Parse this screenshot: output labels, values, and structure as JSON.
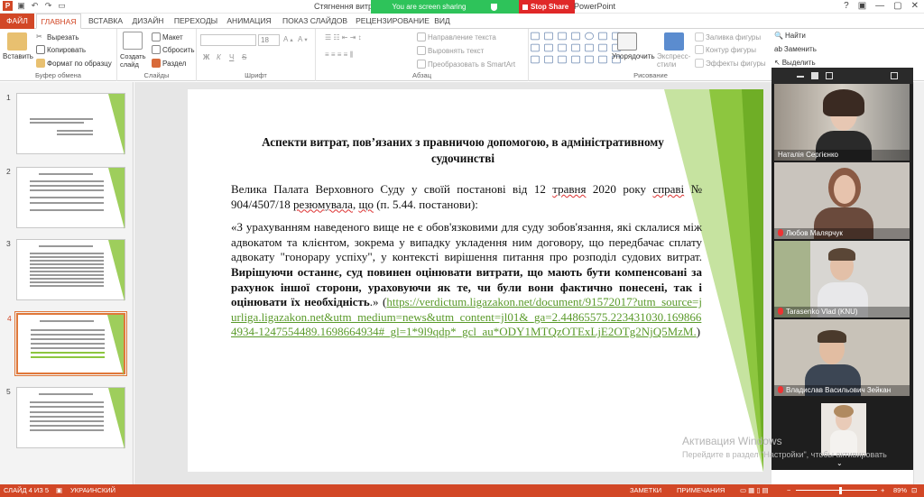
{
  "titlebar": {
    "doc_title": "Стягнення витрат",
    "app_title": "PowerPoint",
    "sharing_text": "You are screen sharing",
    "stop_share": "Stop Share",
    "qat_icons": [
      "powerpoint-icon",
      "save-icon",
      "undo-icon",
      "redo-icon",
      "slideshow-icon"
    ],
    "window_buttons": [
      "?",
      "▢",
      "—",
      "▢",
      "✕"
    ]
  },
  "tabs": [
    "ФАЙЛ",
    "ГЛАВНАЯ",
    "ВСТАВКА",
    "ДИЗАЙН",
    "ПЕРЕХОДЫ",
    "АНИМАЦИЯ",
    "ПОКАЗ СЛАЙДОВ",
    "РЕЦЕНЗИРОВАНИЕ",
    "ВИД"
  ],
  "ribbon": {
    "clipboard": {
      "paste": "Вставить",
      "cut": "Вырезать",
      "copy": "Копировать",
      "format_painter": "Формат по образцу",
      "label": "Буфер обмена"
    },
    "slides": {
      "new_slide": "Создать слайд",
      "layout": "Макет",
      "reset": "Сбросить",
      "section": "Раздел",
      "label": "Слайды"
    },
    "font": {
      "size": "18",
      "label": "Шрифт",
      "bold": "Ж",
      "italic": "К",
      "underline": "Ч",
      "strike": "S"
    },
    "paragraph": {
      "text_direction": "Направление текста",
      "align_text": "Выровнять текст",
      "smartart": "Преобразовать в SmartArt",
      "label": "Абзац"
    },
    "drawing": {
      "arrange": "Упорядочить",
      "quick_styles": "Экспресс-стили",
      "shape_fill": "Заливка фигуры",
      "shape_outline": "Контур фигуры",
      "shape_effects": "Эффекты фигуры",
      "label": "Рисование"
    },
    "editing": {
      "find": "Найти",
      "replace": "Заменить",
      "select": "Выделить"
    }
  },
  "thumbnails": [
    {
      "num": "1"
    },
    {
      "num": "2"
    },
    {
      "num": "3"
    },
    {
      "num": "4"
    },
    {
      "num": "5"
    }
  ],
  "slide": {
    "title": "Аспекти витрат, пов’язаних з правничою допомогою, в адміністративному судочинстві",
    "p1_a": "Велика Палата Верховного Суду у своїй постанові від 12 ",
    "p1_may": "травня",
    "p1_b": " 2020 року ",
    "p1_case": "справі",
    "p1_c": " № 904/4507/18 ",
    "p1_resolved": "резюмувала",
    "p1_d": ", ",
    "p1_that": "що",
    "p1_e": " (п. 5.44. постанови):",
    "p2_a": "«З урахуванням наведеного вище не є обов'язковими для суду зобов'язання, які склалися між адвокатом та клієнтом, зокрема у випадку укладення ним договору, що передбачає сплату адвокату \"гонорару успіху\", у контексті вирішення питання про розподіл судових витрат. ",
    "p2_bold": "Вирішуючи останнє, суд повинен оцінювати витрати, що мають бути компенсовані за рахунок іншої сторони, ураховуючи як те, чи були вони фактично понесені, так і оцінювати їх необхідність",
    "p2_b": ".» (",
    "link": "https://verdictum.ligazakon.net/document/91572017?utm_source=jurliga.ligazakon.net&utm_medium=news&utm_content=jl01&_ga=2.44865575.223431030.1698664934-1247554489.1698664934#_gl=1*9l9qdp*_gcl_au*ODY1MTQzOTExLjE2OTg2NjQ5MzM.",
    "p2_c": ")"
  },
  "participants": [
    {
      "name": "Наталія Сергієнко",
      "muted": false
    },
    {
      "name": "Любов Малярчук",
      "muted": true
    },
    {
      "name": "Tarasenko Vlad (KNU)",
      "muted": true
    },
    {
      "name": "Владислав Васильович Зейкан",
      "muted": true
    }
  ],
  "watermark": {
    "title": "Активация Windows",
    "sub": "Перейдите в раздел \"Настройки\", чтобы активировать"
  },
  "status": {
    "slide": "СЛАЙД 4 ИЗ 5",
    "lang": "УКРАИНСКИЙ",
    "notes": "ЗАМЕТКИ",
    "comments": "ПРИМЕЧАНИЯ",
    "zoom": "89%"
  },
  "colors": {
    "accent": "#d24726",
    "share_green": "#2ec35a",
    "stop_red": "#e02828",
    "slide_green": "#8dc63f"
  }
}
